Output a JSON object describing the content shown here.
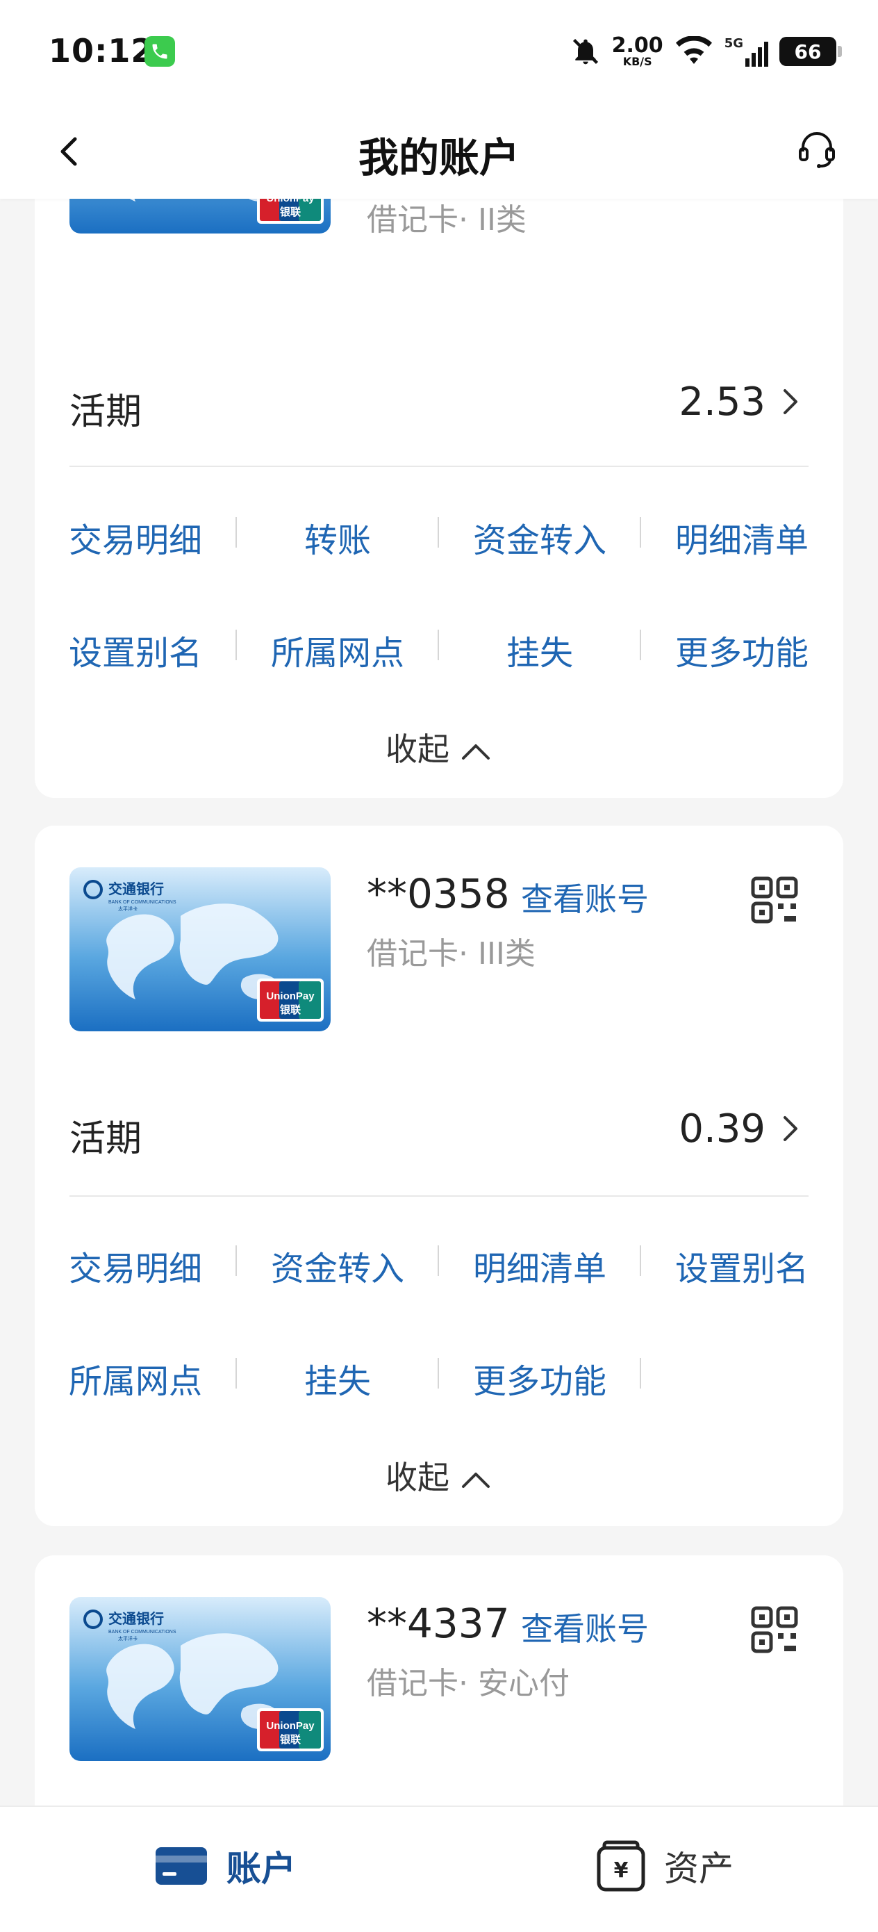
{
  "status_bar": {
    "time": "10:12",
    "net_speed": "2.00",
    "net_unit": "KB/S",
    "signal_label": "5G",
    "battery": "66"
  },
  "nav": {
    "title": "我的账户"
  },
  "accounts": [
    {
      "type": "借记卡· II类",
      "balance_label": "活期",
      "balance": "2.53",
      "actions": [
        "交易明细",
        "转账",
        "资金转入",
        "明细清单",
        "设置别名",
        "所属网点",
        "挂失",
        "更多功能"
      ],
      "collapse_label": "收起"
    },
    {
      "number": "**0358",
      "view_label": "查看账号",
      "type": "借记卡· III类",
      "balance_label": "活期",
      "balance": "0.39",
      "actions": [
        "交易明细",
        "资金转入",
        "明细清单",
        "设置别名",
        "所属网点",
        "挂失",
        "更多功能"
      ],
      "collapse_label": "收起"
    },
    {
      "number": "**4337",
      "view_label": "查看账号",
      "type": "借记卡· 安心付"
    }
  ],
  "card_art": {
    "bank_name": "交通银行",
    "bank_name_en": "BANK OF COMMUNICATIONS",
    "card_series": "太平洋卡",
    "network": "UnionPay",
    "network_cn": "银联"
  },
  "tabbar": {
    "tabs": [
      {
        "label": "账户",
        "active": true
      },
      {
        "label": "资产",
        "active": false
      }
    ]
  },
  "colors": {
    "accent": "#1f66b3",
    "tab_active": "#174f94",
    "background": "#f5f5f5"
  }
}
